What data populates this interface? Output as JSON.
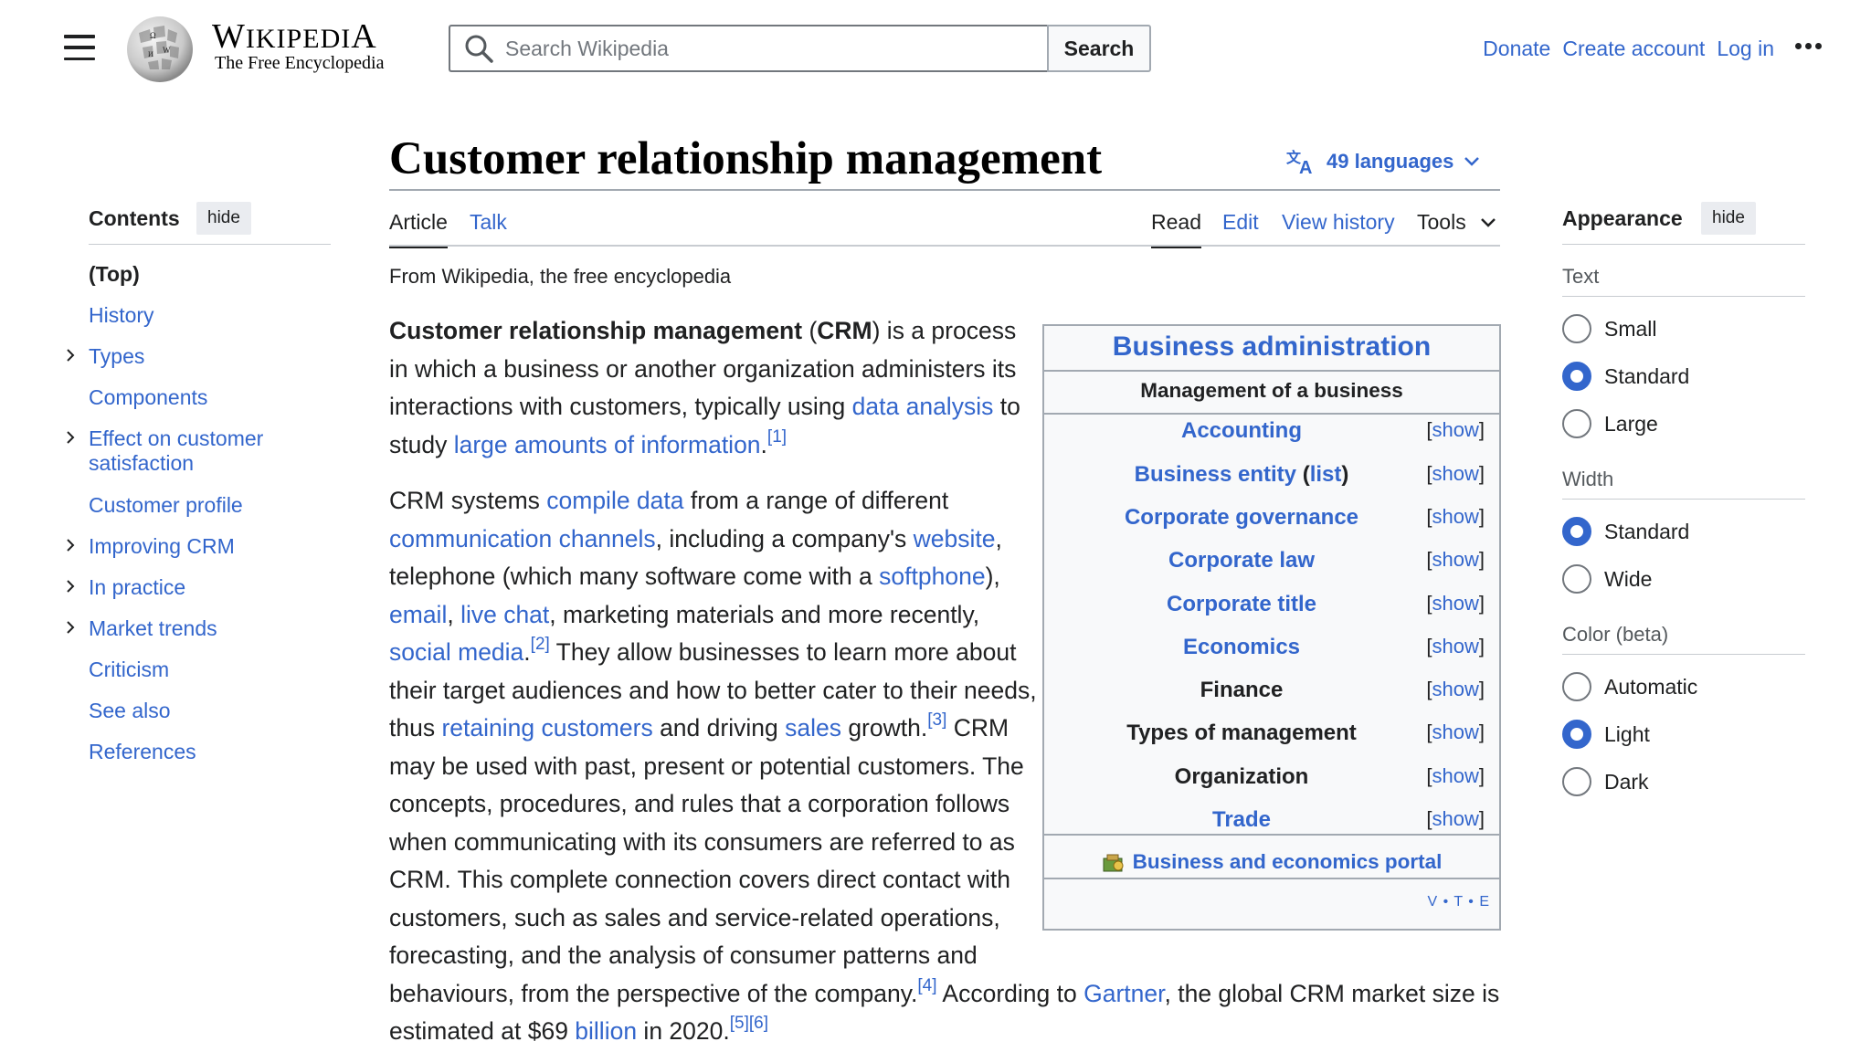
{
  "header": {
    "wordmark": "WIKIPEDIA",
    "tagline": "The Free Encyclopedia",
    "search_placeholder": "Search Wikipedia",
    "search_button": "Search",
    "donate": "Donate",
    "create_account": "Create account",
    "log_in": "Log in"
  },
  "article": {
    "title": "Customer relationship management",
    "languages": "49 languages",
    "tabs": {
      "article": "Article",
      "talk": "Talk",
      "read": "Read",
      "edit": "Edit",
      "view_history": "View history",
      "tools": "Tools"
    },
    "from": "From Wikipedia, the free encyclopedia"
  },
  "toc": {
    "heading": "Contents",
    "hide": "hide",
    "items": [
      {
        "label": "(Top)",
        "expandable": false
      },
      {
        "label": "History",
        "expandable": false
      },
      {
        "label": "Types",
        "expandable": true
      },
      {
        "label": "Components",
        "expandable": false
      },
      {
        "label": "Effect on customer\nsatisfaction",
        "expandable": true
      },
      {
        "label": "Customer profile",
        "expandable": false
      },
      {
        "label": "Improving CRM",
        "expandable": true
      },
      {
        "label": "In practice",
        "expandable": true
      },
      {
        "label": "Market trends",
        "expandable": true
      },
      {
        "label": "Criticism",
        "expandable": false
      },
      {
        "label": "See also",
        "expandable": false
      },
      {
        "label": "References",
        "expandable": false
      }
    ]
  },
  "appearance": {
    "heading": "Appearance",
    "hide": "hide",
    "text_label": "Text",
    "text_options": [
      "Small",
      "Standard",
      "Large"
    ],
    "text_selected": "Standard",
    "width_label": "Width",
    "width_options": [
      "Standard",
      "Wide"
    ],
    "width_selected": "Standard",
    "color_label": "Color (beta)",
    "color_options": [
      "Automatic",
      "Light",
      "Dark"
    ],
    "color_selected": "Light"
  },
  "infobox": {
    "title": "Business administration",
    "subtitle": "Management of a business",
    "rows": [
      {
        "name": "Accounting",
        "linked": true
      },
      {
        "name": "Business entity (list)",
        "linked": true
      },
      {
        "name": "Corporate governance",
        "linked": true
      },
      {
        "name": "Corporate law",
        "linked": true
      },
      {
        "name": "Corporate title",
        "linked": true
      },
      {
        "name": "Economics",
        "linked": true
      },
      {
        "name": "Finance",
        "linked": false
      },
      {
        "name": "Types of management",
        "linked": false
      },
      {
        "name": "Organization",
        "linked": false
      },
      {
        "name": "Trade",
        "linked": true
      }
    ],
    "show_label": "show",
    "portal": "Business and economics portal",
    "vte": "V • T • E"
  },
  "body": {
    "p1": [
      [
        {
          "t": "Customer relationship management",
          "b": true
        },
        {
          "t": " ("
        },
        {
          "t": "CRM",
          "b": true
        },
        {
          "t": ") is a process"
        }
      ],
      [
        {
          "t": "in which a business or another organization administers its"
        }
      ],
      [
        {
          "t": "interactions with customers, typically using "
        },
        {
          "t": "data analysis",
          "l": true
        },
        {
          "t": " to"
        }
      ],
      [
        {
          "t": "study "
        },
        {
          "t": "large amounts of information",
          "l": true
        },
        {
          "t": "."
        },
        {
          "t": "[1]",
          "s": true
        }
      ]
    ],
    "p2": [
      [
        {
          "t": "CRM systems "
        },
        {
          "t": "compile data",
          "l": true
        },
        {
          "t": " from a range of different"
        }
      ],
      [
        {
          "t": "communication channels",
          "l": true
        },
        {
          "t": ", including a company's "
        },
        {
          "t": "website",
          "l": true
        },
        {
          "t": ","
        }
      ],
      [
        {
          "t": "telephone (which many software come with a "
        },
        {
          "t": "softphone",
          "l": true
        },
        {
          "t": "),"
        }
      ],
      [
        {
          "t": "email",
          "l": true
        },
        {
          "t": ", "
        },
        {
          "t": "live chat",
          "l": true
        },
        {
          "t": ", marketing materials and more recently,"
        }
      ],
      [
        {
          "t": "social media",
          "l": true
        },
        {
          "t": "."
        },
        {
          "t": "[2]",
          "s": true
        },
        {
          "t": " They allow businesses to learn more about"
        }
      ],
      [
        {
          "t": "their target audiences and how to better cater to their needs,"
        }
      ],
      [
        {
          "t": "thus "
        },
        {
          "t": "retaining customers",
          "l": true
        },
        {
          "t": " and driving "
        },
        {
          "t": "sales",
          "l": true
        },
        {
          "t": " growth."
        },
        {
          "t": "[3]",
          "s": true
        },
        {
          "t": " CRM"
        }
      ],
      [
        {
          "t": "may be used with past, present or potential customers. The"
        }
      ],
      [
        {
          "t": "concepts, procedures, and rules that a corporation follows"
        }
      ],
      [
        {
          "t": "when communicating with its consumers are referred to as"
        }
      ],
      [
        {
          "t": "CRM. This complete connection covers direct contact with"
        }
      ],
      [
        {
          "t": "customers, such as sales and service-related operations,"
        }
      ],
      [
        {
          "t": "forecasting, and the analysis of consumer patterns and"
        }
      ],
      [
        {
          "t": "behaviours, from the perspective of the company."
        },
        {
          "t": "[4]",
          "s": true
        },
        {
          "t": " According to "
        },
        {
          "t": "Gartner",
          "l": true
        },
        {
          "t": ", the global CRM market size is"
        }
      ],
      [
        {
          "t": "estimated at $69 "
        },
        {
          "t": "billion",
          "l": true
        },
        {
          "t": " in 2020."
        },
        {
          "t": "[5][6]",
          "s": true
        }
      ]
    ]
  }
}
